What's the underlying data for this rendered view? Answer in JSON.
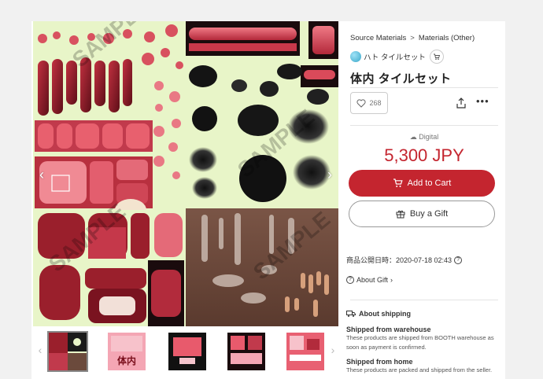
{
  "gallery": {
    "prev_arrow": "‹",
    "next_arrow": "›",
    "thumb_prev": "‹",
    "thumb_next": "›",
    "watermark": "SAMPLE",
    "thumbnails": [
      {
        "caption": ""
      },
      {
        "caption": "体内"
      },
      {
        "caption": ""
      },
      {
        "caption": ""
      },
      {
        "caption": ""
      }
    ]
  },
  "breadcrumb": {
    "items": [
      "Source Materials",
      "Materials (Other)"
    ],
    "separator": ">"
  },
  "shop": {
    "name": "ハト タイルセット"
  },
  "product": {
    "title": "体内 タイルセット",
    "likes": "268",
    "type": "Digital",
    "price": "5,300 JPY"
  },
  "actions": {
    "add_to_cart": "Add to Cart",
    "buy_gift": "Buy a Gift"
  },
  "meta": {
    "published": "商品公開日時：2020-07-18 02:43",
    "about_gift": "About Gift"
  },
  "shipping": {
    "heading": "About shipping",
    "warehouse_title": "Shipped from warehouse",
    "warehouse_desc": "These products are shipped from BOOTH warehouse as soon as payment is confirmed.",
    "home_title": "Shipped from home",
    "home_desc": "These products are packed and shipped from the seller."
  },
  "colors": {
    "accent": "#c4252f",
    "tile_background": "#e8f5c8",
    "flesh_dark": "#8b1a24",
    "flesh_light": "#e8606e",
    "brown": "#6b4a3c"
  }
}
